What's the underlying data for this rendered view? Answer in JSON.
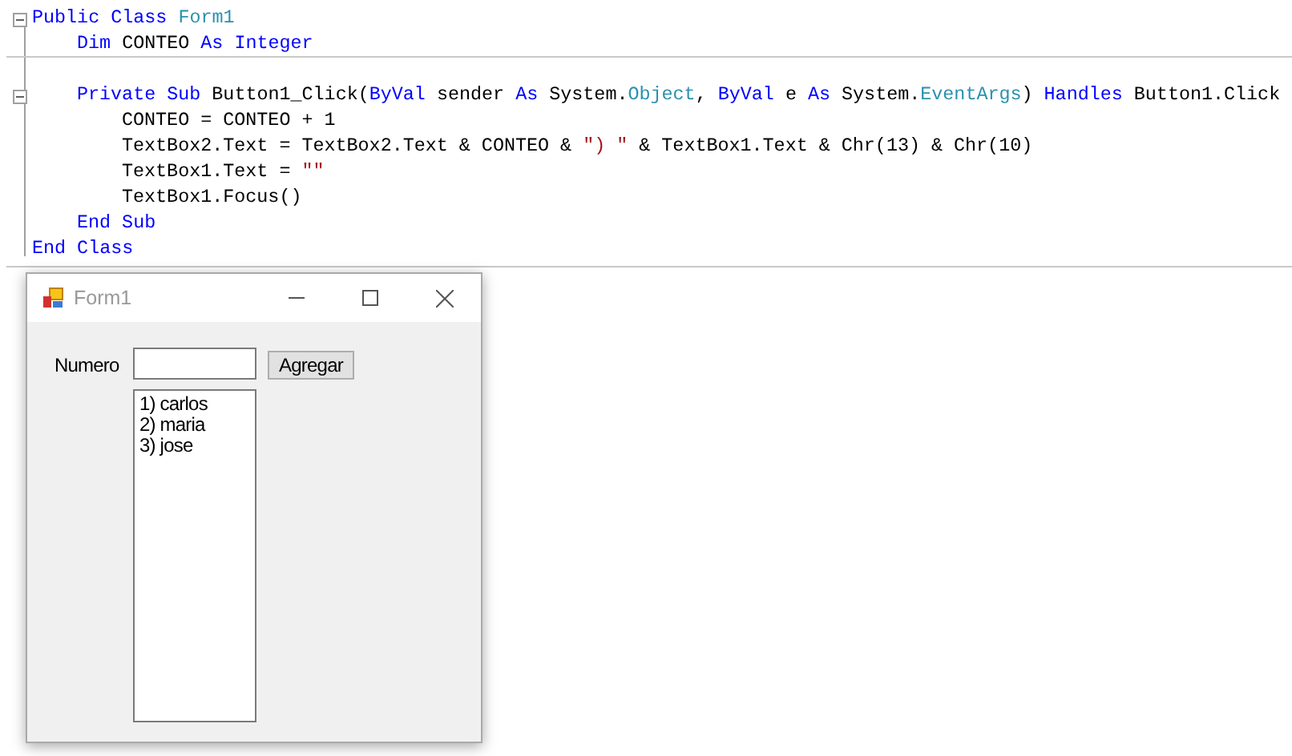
{
  "code": {
    "lines": [
      {
        "tokens": [
          {
            "t": "Public Class ",
            "kind": "kw"
          },
          {
            "t": "Form1",
            "kind": "type"
          }
        ],
        "expanded": true,
        "children": [
          {
            "tokens": [
              {
                "t": "Dim ",
                "kind": "kw"
              },
              {
                "t": "CONTEO ",
                "kind": "plain"
              },
              {
                "t": "As Integer",
                "kind": "kw"
              }
            ],
            "separator": true
          },
          {
            "tokens": [
              {
                "t": "Private Sub ",
                "kind": "kw"
              },
              {
                "t": "Button1_Click(",
                "kind": "plain"
              },
              {
                "t": "ByVal ",
                "kind": "kw"
              },
              {
                "t": "sender ",
                "kind": "plain"
              },
              {
                "t": "As ",
                "kind": "kw"
              },
              {
                "t": "System.",
                "kind": "plain"
              },
              {
                "t": "Object",
                "kind": "type"
              },
              {
                "t": ", ",
                "kind": "plain"
              },
              {
                "t": "ByVal ",
                "kind": "kw"
              },
              {
                "t": "e ",
                "kind": "plain"
              },
              {
                "t": "As ",
                "kind": "kw"
              },
              {
                "t": "System.",
                "kind": "plain"
              },
              {
                "t": "EventArgs",
                "kind": "type"
              },
              {
                "t": ") ",
                "kind": "plain"
              },
              {
                "t": "Handles ",
                "kind": "kw"
              },
              {
                "t": "Button1.Click",
                "kind": "plain"
              }
            ],
            "expanded": true,
            "children": [
              {
                "tokens": [
                  {
                    "t": "CONTEO = CONTEO + 1",
                    "kind": "plain"
                  }
                ]
              },
              {
                "tokens": [
                  {
                    "t": "TextBox2.Text = TextBox2.Text & CONTEO & ",
                    "kind": "plain"
                  },
                  {
                    "t": "\") \"",
                    "kind": "str"
                  },
                  {
                    "t": " & TextBox1.Text & Chr(13) & Chr(10)",
                    "kind": "plain"
                  }
                ]
              },
              {
                "tokens": [
                  {
                    "t": "TextBox1.Text = ",
                    "kind": "plain"
                  },
                  {
                    "t": "\"\"",
                    "kind": "str"
                  }
                ]
              },
              {
                "tokens": [
                  {
                    "t": "TextBox1.Focus()",
                    "kind": "plain"
                  }
                ]
              }
            ]
          },
          {
            "tokens": [
              {
                "t": "End Sub",
                "kind": "kw"
              }
            ]
          }
        ]
      },
      {
        "tokens": [
          {
            "t": "End Class",
            "kind": "kw"
          }
        ]
      }
    ]
  },
  "form": {
    "title": "Form1",
    "label": "Numero",
    "button": "Agregar",
    "list": [
      "1) carlos",
      "2) maria",
      "3) jose"
    ]
  }
}
